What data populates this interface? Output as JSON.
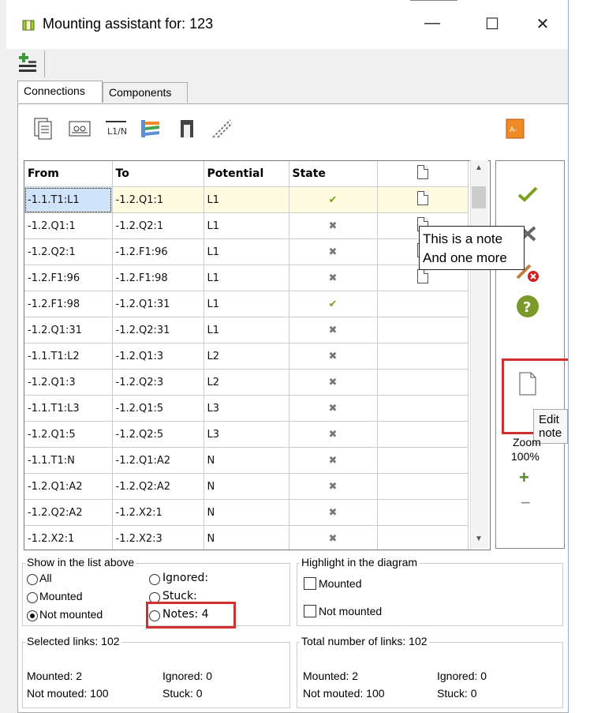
{
  "window": {
    "title": "Mounting assistant for: 123",
    "minimize": "—",
    "maximize": "☐",
    "close": "✕"
  },
  "tabs": [
    {
      "label": "Connections"
    },
    {
      "label": "Components"
    }
  ],
  "table": {
    "headers": [
      "From",
      "To",
      "Potential",
      "State"
    ],
    "rows": [
      {
        "from": "-1.1.T1:L1",
        "to": "-1.2.Q1:1",
        "potential": "L1",
        "state": "✔",
        "note": true
      },
      {
        "from": "-1.2.Q1:1",
        "to": "-1.2.Q2:1",
        "potential": "L1",
        "state": "✖",
        "note": true
      },
      {
        "from": "-1.2.Q2:1",
        "to": "-1.2.F1:96",
        "potential": "L1",
        "state": "✖",
        "note": true
      },
      {
        "from": "-1.2.F1:96",
        "to": "-1.2.F1:98",
        "potential": "L1",
        "state": "✖",
        "note": true
      },
      {
        "from": "-1.2.F1:98",
        "to": "-1.2.Q1:31",
        "potential": "L1",
        "state": "✔",
        "note": false
      },
      {
        "from": "-1.2.Q1:31",
        "to": "-1.2.Q2:31",
        "potential": "L1",
        "state": "✖",
        "note": false
      },
      {
        "from": "-1.1.T1:L2",
        "to": "-1.2.Q1:3",
        "potential": "L2",
        "state": "✖",
        "note": false
      },
      {
        "from": "-1.2.Q1:3",
        "to": "-1.2.Q2:3",
        "potential": "L2",
        "state": "✖",
        "note": false
      },
      {
        "from": "-1.1.T1:L3",
        "to": "-1.2.Q1:5",
        "potential": "L3",
        "state": "✖",
        "note": false
      },
      {
        "from": "-1.2.Q1:5",
        "to": "-1.2.Q2:5",
        "potential": "L3",
        "state": "✖",
        "note": false
      },
      {
        "from": "-1.1.T1:N",
        "to": "-1.2.Q1:A2",
        "potential": "N",
        "state": "✖",
        "note": false
      },
      {
        "from": "-1.2.Q1:A2",
        "to": "-1.2.Q2:A2",
        "potential": "N",
        "state": "✖",
        "note": false
      },
      {
        "from": "-1.2.Q2:A2",
        "to": "-1.2.X2:1",
        "potential": "N",
        "state": "✖",
        "note": false
      },
      {
        "from": "-1.2.X2:1",
        "to": "-1.2.X2:3",
        "potential": "N",
        "state": "✖",
        "note": false
      }
    ]
  },
  "tooltip_note": {
    "line1": "This is a note",
    "line2": "And one more"
  },
  "side": {
    "edit_note_tooltip": "Edit note",
    "zoom_label": "Zoom",
    "zoom_value": "100%",
    "zoom_in": "+",
    "zoom_out": "−"
  },
  "show_group": {
    "title": "Show in the list above",
    "all": "All",
    "mounted": "Mounted",
    "not_mounted": "Not mounted",
    "ignored": "Ignored:",
    "stuck": "Stuck:",
    "notes": "Notes: 4"
  },
  "highlight_group": {
    "title": "Highlight in the diagram",
    "mounted": "Mounted",
    "not_mounted": "Not mounted"
  },
  "selected_group": {
    "title": "Selected links: 102",
    "mounted": "Mounted: 2",
    "not_mounted": "Not mouted: 100",
    "ignored": "Ignored: 0",
    "stuck": "Stuck: 0"
  },
  "total_group": {
    "title": "Total number of links: 102",
    "mounted": "Mounted: 2",
    "not_mounted": "Not mouted: 100",
    "ignored": "Ignored: 0",
    "stuck": "Stuck: 0"
  },
  "colors": {
    "check": "#7aa020",
    "cross": "#777777",
    "highlight_red": "#d03030",
    "selected_row": "#fffbe0"
  }
}
